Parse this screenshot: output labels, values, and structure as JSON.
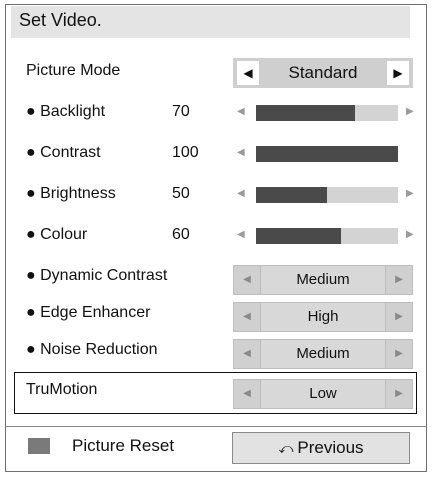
{
  "header": {
    "title": "Set Video."
  },
  "picture_mode": {
    "label": "Picture Mode",
    "value": "Standard",
    "left_icon": "left-triangle-icon",
    "right_icon": "right-triangle-icon"
  },
  "sliders": [
    {
      "label": "● Backlight",
      "value": "70",
      "level": 0.7,
      "show_right_arrow": true
    },
    {
      "label": "● Contrast",
      "value": "100",
      "level": 1.0,
      "show_right_arrow": false
    },
    {
      "label": "● Brightness",
      "value": "50",
      "level": 0.5,
      "show_right_arrow": true
    },
    {
      "label": "● Colour",
      "value": "60",
      "level": 0.6,
      "show_right_arrow": true
    }
  ],
  "selectors": [
    {
      "label": "● Dynamic Contrast",
      "value": "Medium"
    },
    {
      "label": "● Edge Enhancer",
      "value": "High"
    },
    {
      "label": "● Noise Reduction",
      "value": "Medium"
    },
    {
      "label": "TruMotion",
      "value": "Low"
    }
  ],
  "footer": {
    "reset_label": "Picture Reset",
    "previous_label": "Previous",
    "previous_icon": "return-arrow-icon",
    "reset_swatch_color": "#7a7a7a"
  },
  "colors": {
    "title_bar": "#e4e4e4",
    "slider_fill": "#4a4a4a",
    "slider_track": "#d3d3d3"
  }
}
